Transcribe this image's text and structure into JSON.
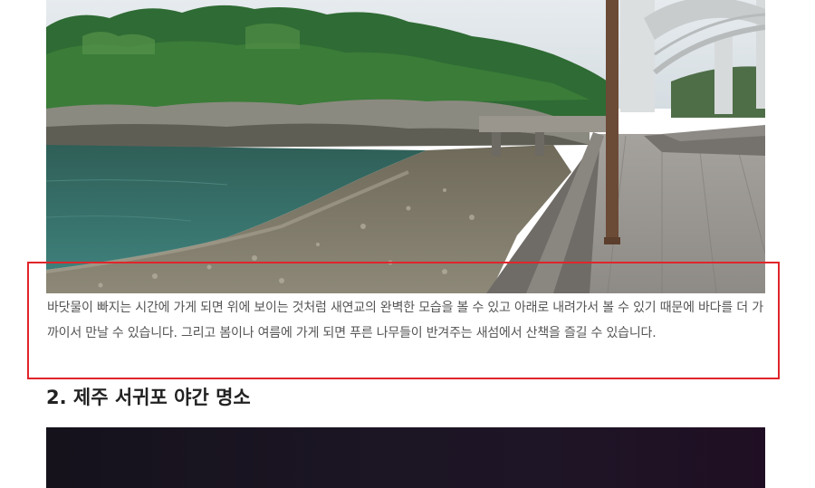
{
  "article": {
    "paragraph": "바닷물이 빠지는 시간에 가게 되면 위에 보이는 것처럼 새연교의 완벽한 모습을 볼 수 있고 아래로 내려가서 볼 수 있기 때문에 바다를 더 가까이서 만날 수 있습니다. 그리고 봄이나 여름에 가게 되면 푸른 나무들이 반겨주는 새섬에서 산책을 즐길 수 있습니다.",
    "section_heading": "2. 제주 서귀포 야간 명소"
  },
  "colors": {
    "highlight_border": "#e0252b",
    "body_text": "#555555",
    "heading_text": "#222222"
  }
}
